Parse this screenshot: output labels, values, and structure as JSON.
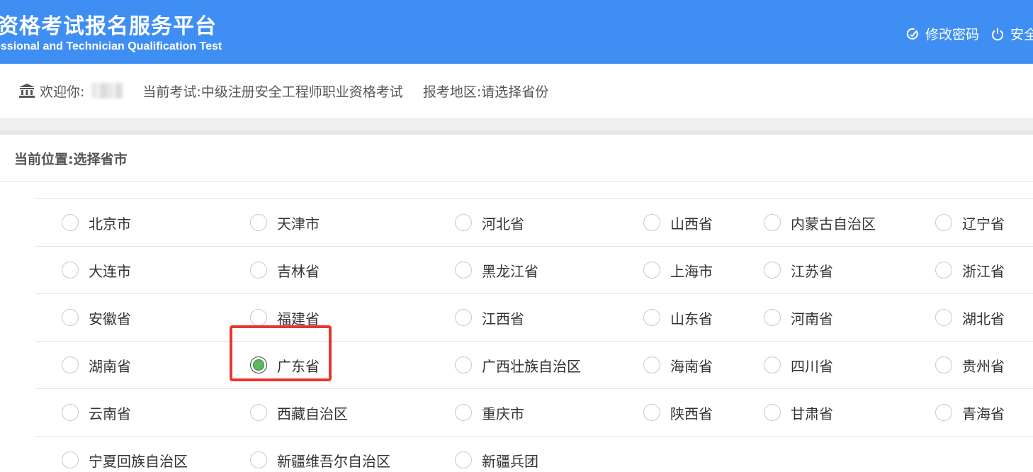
{
  "header": {
    "title": "资格考试报名服务平台",
    "subtitle": "essional and Technician Qualification Test",
    "change_password": "修改密码",
    "logout": "安全"
  },
  "info": {
    "welcome_label": "欢迎你:",
    "current_exam": "当前考试:中级注册安全工程师职业资格考试",
    "region": "报考地区:请选择省份"
  },
  "breadcrumb": "当前位置:选择省市",
  "provinces": [
    [
      "北京市",
      "天津市",
      "河北省",
      "山西省",
      "内蒙古自治区",
      "辽宁省"
    ],
    [
      "大连市",
      "吉林省",
      "黑龙江省",
      "上海市",
      "江苏省",
      "浙江省"
    ],
    [
      "安徽省",
      "福建省",
      "江西省",
      "山东省",
      "河南省",
      "湖北省"
    ],
    [
      "湖南省",
      "广东省",
      "广西壮族自治区",
      "海南省",
      "四川省",
      "贵州省"
    ],
    [
      "云南省",
      "西藏自治区",
      "重庆市",
      "陕西省",
      "甘肃省",
      "青海省"
    ],
    [
      "宁夏回族自治区",
      "新疆维吾尔自治区",
      "新疆兵团"
    ]
  ],
  "selected": "广东省",
  "colors": {
    "header_bg": "#3f8ef3",
    "highlight": "#e8372f",
    "radio_checked": "#5cb85c"
  }
}
